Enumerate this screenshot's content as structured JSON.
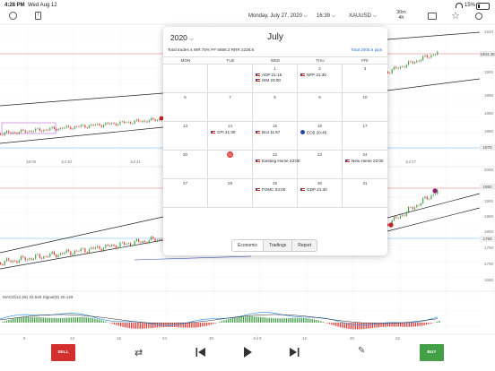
{
  "status_bar": {
    "time": "4:28 PM",
    "date": "Wed Aug 12",
    "battery": "15%"
  },
  "toolbar": {
    "date_label": "Monday, July 27, 2020",
    "time_label": "16:39",
    "symbol": "XAUUSD",
    "timeframe_top": "30m",
    "timeframe_bottom": "4h"
  },
  "price_axis_top": [
    "1910",
    "1906",
    "1900",
    "1895",
    "1890",
    "1880"
  ],
  "price_tags_top": [
    "1904.38",
    "1870"
  ],
  "time_axis_top": [
    "18:00",
    "Jul 20",
    "Jul 21",
    "Jul 27"
  ],
  "price_axis_bottom": [
    "2000",
    "1950",
    "1900",
    "1850",
    "1800",
    "1750",
    "1700",
    "1650"
  ],
  "price_tags_bottom": [
    "1950",
    "1760"
  ],
  "macd_label": "MACD(12,26) 33.545 Signal(9) 20.149",
  "time_axis_bottom": [
    "8",
    "12",
    "16",
    "20",
    "24",
    "30",
    "Jul 8",
    "12",
    "16",
    "20",
    "22",
    "24"
  ],
  "calendar": {
    "year": "2020",
    "month": "July",
    "stats": "Total trades 4  WR 75%  PF 6686.3  RRR 2228.8",
    "total_link": "Total 2005.6 pips",
    "weekdays": [
      "MON",
      "TUE",
      "WED",
      "THU",
      "FRI"
    ],
    "weeks": [
      [
        {
          "day": "",
          "events": []
        },
        {
          "day": "",
          "events": []
        },
        {
          "day": "1",
          "events": [
            {
              "flag": "us",
              "text": "ADP  21:15"
            },
            {
              "flag": "us",
              "text": "ISM  23:00"
            }
          ]
        },
        {
          "day": "2",
          "events": [
            {
              "flag": "us",
              "text": "NFP  21:30"
            }
          ]
        },
        {
          "day": "3",
          "events": []
        }
      ],
      [
        {
          "day": "6",
          "events": []
        },
        {
          "day": "7",
          "events": []
        },
        {
          "day": "8",
          "events": []
        },
        {
          "day": "9",
          "events": []
        },
        {
          "day": "10",
          "events": []
        }
      ],
      [
        {
          "day": "13",
          "events": []
        },
        {
          "day": "14",
          "events": [
            {
              "flag": "us",
              "text": "CPI  21:30"
            }
          ]
        },
        {
          "day": "15",
          "events": [
            {
              "flag": "us",
              "text": "BoJ  11:57"
            }
          ]
        },
        {
          "day": "16",
          "events": [
            {
              "flag": "eu",
              "text": "ECB  20:45"
            }
          ]
        },
        {
          "day": "17",
          "events": []
        }
      ],
      [
        {
          "day": "20",
          "events": []
        },
        {
          "day": "21",
          "today": true,
          "events": []
        },
        {
          "day": "22",
          "events": [
            {
              "flag": "us",
              "text": "Existing Home  23:00"
            }
          ]
        },
        {
          "day": "23",
          "events": []
        },
        {
          "day": "24",
          "events": [
            {
              "flag": "us",
              "text": "New Home  23:00"
            }
          ]
        }
      ],
      [
        {
          "day": "27",
          "events": []
        },
        {
          "day": "28",
          "events": []
        },
        {
          "day": "29",
          "events": [
            {
              "flag": "us",
              "text": "FOMC  03:00"
            }
          ]
        },
        {
          "day": "30",
          "events": [
            {
              "flag": "us",
              "text": "GDP  21:30"
            }
          ]
        },
        {
          "day": "31",
          "events": []
        }
      ]
    ],
    "tabs": [
      "Economic",
      "Tradings",
      "Report"
    ],
    "active_tab": "Economic"
  },
  "bottom_bar": {
    "sell_label": "SELL",
    "buy_label": "BUY",
    "sell_color": "#d32f2f",
    "buy_color": "#43a047"
  }
}
